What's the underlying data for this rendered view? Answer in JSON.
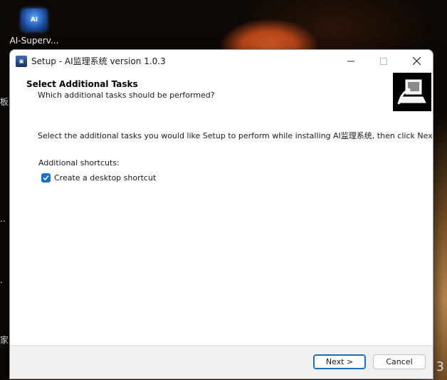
{
  "desktop": {
    "icon_label": "AI-Superv...",
    "icon_art": "AI",
    "edge_glyphs": [
      "板",
      "..",
      ".",
      "家"
    ],
    "right_mark": "3"
  },
  "window": {
    "title": "Setup - AI监理系统 version 1.0.3",
    "app_icon": "setup-app-icon",
    "controls": [
      "minimize-icon",
      "maximize-icon",
      "close-icon"
    ]
  },
  "page": {
    "heading": "Select Additional Tasks",
    "subheading": "Which additional tasks should be performed?",
    "wizard_image": "computer-install-icon",
    "instruction": "Select the additional tasks you would like Setup to perform while installing AI监理系统, then click Next.",
    "group_label": "Additional shortcuts:",
    "tasks": [
      {
        "label": "Create a desktop shortcut",
        "checked": true
      }
    ]
  },
  "buttons": {
    "next": "Next >",
    "cancel": "Cancel"
  },
  "colors": {
    "accent": "#1a6fc4",
    "footer": "#f0f0f0"
  }
}
